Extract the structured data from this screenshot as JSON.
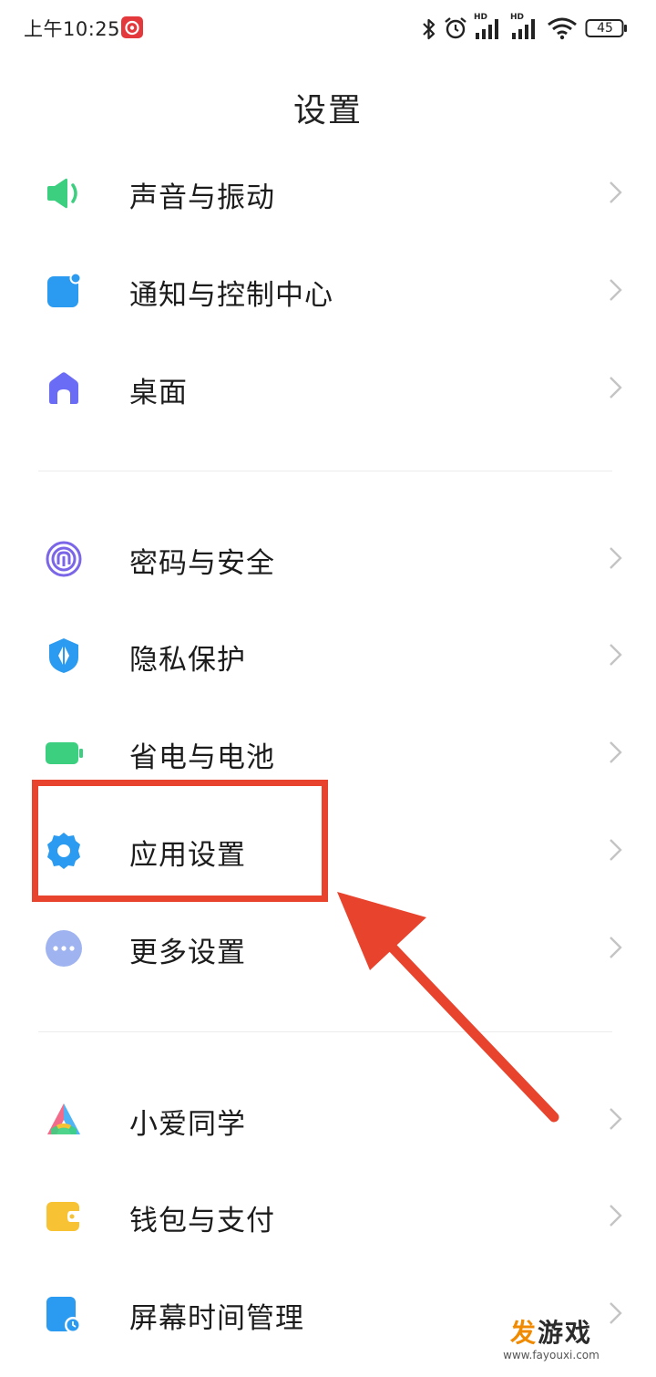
{
  "status_bar": {
    "time": "上午10:25",
    "app_icon": "netease-music-icon",
    "icons": [
      "bluetooth-icon",
      "alarm-icon",
      "signal-hd-1-icon",
      "signal-hd-2-icon",
      "wifi-icon",
      "battery-icon"
    ],
    "network_label_1": "HD",
    "network_label_2": "HD",
    "battery_level": "45"
  },
  "header": {
    "title": "设置"
  },
  "groups": [
    {
      "items": [
        {
          "label": "声音与振动",
          "icon": "speaker-icon",
          "color": "#3ccf7f"
        },
        {
          "label": "通知与控制中心",
          "icon": "notification-icon",
          "color": "#2a9bf0"
        },
        {
          "label": "桌面",
          "icon": "home-icon",
          "color": "#6b6cf5"
        }
      ]
    },
    {
      "items": [
        {
          "label": "密码与安全",
          "icon": "fingerprint-icon",
          "color": "#7b66e8"
        },
        {
          "label": "隐私保护",
          "icon": "privacy-shield-icon",
          "color": "#2a9bf0"
        },
        {
          "label": "省电与电池",
          "icon": "battery-icon",
          "color": "#3ccf7f"
        },
        {
          "label": "应用设置",
          "icon": "gear-icon",
          "color": "#2a9bf0"
        },
        {
          "label": "更多设置",
          "icon": "more-icon",
          "color": "#9fb3f0"
        }
      ]
    },
    {
      "items": [
        {
          "label": "小爱同学",
          "icon": "xiaoai-icon",
          "color": "#f26b8a"
        },
        {
          "label": "钱包与支付",
          "icon": "wallet-icon",
          "color": "#f7c233"
        },
        {
          "label": "屏幕时间管理",
          "icon": "screen-time-icon",
          "color": "#2a9bf0"
        }
      ]
    }
  ],
  "annotation": {
    "highlight_color": "#e8432d",
    "highlighted_item": "应用设置"
  },
  "watermark": {
    "title_first": "发",
    "title_rest": "游戏",
    "url": "www.fayouxi.com",
    "accent_color": "#f08a00"
  }
}
